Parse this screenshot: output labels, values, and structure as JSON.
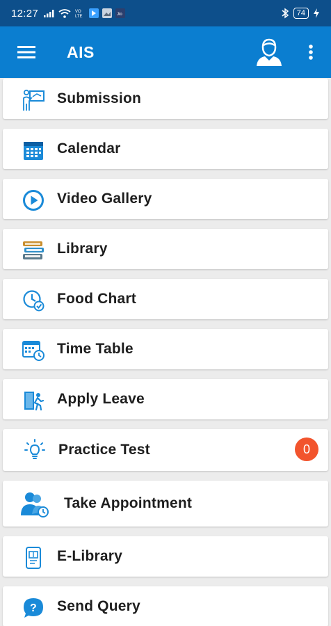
{
  "status_bar": {
    "time": "12:27",
    "battery": "74",
    "icons": [
      "signal-icon",
      "wifi-icon",
      "volte-icon",
      "notification-icon",
      "image-icon",
      "bluetooth-icon",
      "battery-icon",
      "charging-icon"
    ]
  },
  "app_bar": {
    "title": "AIS",
    "icons": [
      "menu-icon",
      "profile-icon",
      "more-vert-icon"
    ]
  },
  "menu": {
    "items": [
      {
        "label": "Submission",
        "icon": "teacher-board-icon"
      },
      {
        "label": "Calendar",
        "icon": "calendar-icon"
      },
      {
        "label": "Video Gallery",
        "icon": "play-circle-icon"
      },
      {
        "label": "Library",
        "icon": "books-icon"
      },
      {
        "label": "Food Chart",
        "icon": "food-clock-icon"
      },
      {
        "label": "Time Table",
        "icon": "timetable-icon"
      },
      {
        "label": "Apply Leave",
        "icon": "exit-door-icon"
      },
      {
        "label": "Practice Test",
        "icon": "lightbulb-icon",
        "badge": "0"
      },
      {
        "label": "Take Appointment",
        "icon": "appointment-icon"
      },
      {
        "label": "E-Library",
        "icon": "e-library-icon"
      },
      {
        "label": "Send Query",
        "icon": "query-bubble-icon"
      }
    ]
  },
  "colors": {
    "status_bar": "#0d4f8b",
    "app_bar": "#0b7ed0",
    "icon_blue": "#1a8ad8",
    "badge": "#f2542d"
  }
}
